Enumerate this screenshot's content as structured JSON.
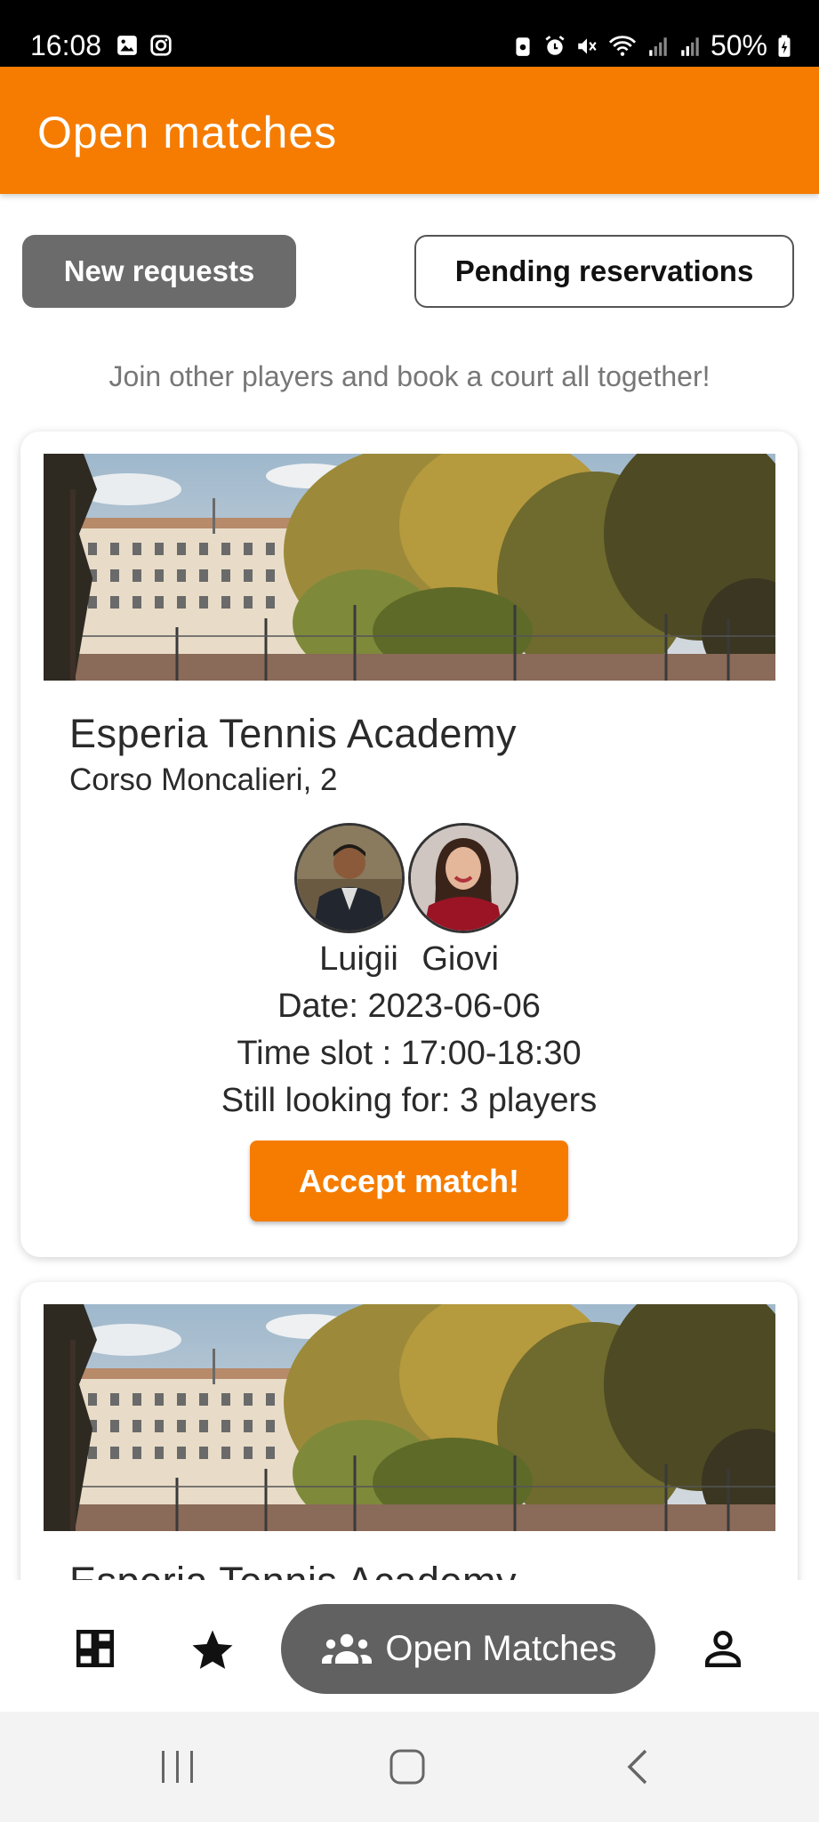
{
  "status_bar": {
    "time": "16:08",
    "battery": "50%",
    "icons": [
      "image-icon",
      "instagram-icon",
      "battery-saver-icon",
      "alarm-icon",
      "mute-icon",
      "wifi-icon",
      "signal-icon",
      "signal-icon",
      "battery-icon"
    ]
  },
  "app_bar": {
    "title": "Open matches"
  },
  "toggle": {
    "new_requests": "New requests",
    "pending_reservations": "Pending reservations"
  },
  "subtitle": "Join other players and book a court all together!",
  "matches": [
    {
      "court_name": "Esperia Tennis Academy",
      "address": "Corso Moncalieri, 2",
      "players": [
        "Luigii",
        "Giovi"
      ],
      "date": "Date: 2023-06-06",
      "time_slot": "Time slot : 17:00-18:30",
      "looking_for": "Still looking for: 3 players",
      "accept_label": "Accept match!"
    },
    {
      "court_name": "Esperia Tennis Academy"
    }
  ],
  "bottom_nav": {
    "items": [
      "dashboard-icon",
      "star-icon",
      "group-icon",
      "person-icon"
    ],
    "active_label": "Open Matches"
  },
  "colors": {
    "accent": "#F57C00",
    "toggle_active": "#6b6b6b",
    "nav_pill": "#616161"
  }
}
